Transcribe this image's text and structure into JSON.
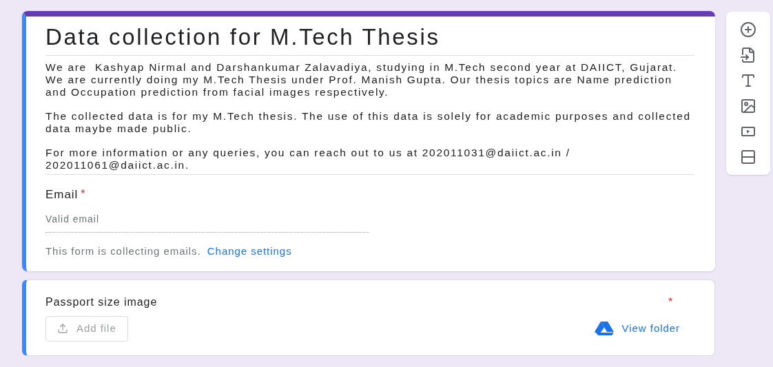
{
  "form": {
    "title": "Data collection for M.Tech Thesis",
    "description": [
      "We are  Kashyap Nirmal and Darshankumar Zalavadiya, studying in M.Tech second year at DAIICT, Gujarat. We are currently doing my M.Tech Thesis under Prof. Manish Gupta. Our thesis topics are Name prediction and Occupation prediction from facial images respectively.",
      "The collected data is for my M.Tech thesis. The use of this data is solely for academic purposes and collected data maybe made public.",
      "For more information or any queries, you can reach out to us at 202011031@daiict.ac.in / 202011061@daiict.ac.in."
    ],
    "email": {
      "label": "Email",
      "required_mark": "*",
      "placeholder": "Valid email",
      "note": "This form is collecting emails.",
      "link": "Change settings"
    }
  },
  "questions": [
    {
      "kind": "file_upload",
      "label": "Passport size image",
      "required_mark": "*",
      "button": "Add file",
      "link": "View folder"
    }
  ]
}
